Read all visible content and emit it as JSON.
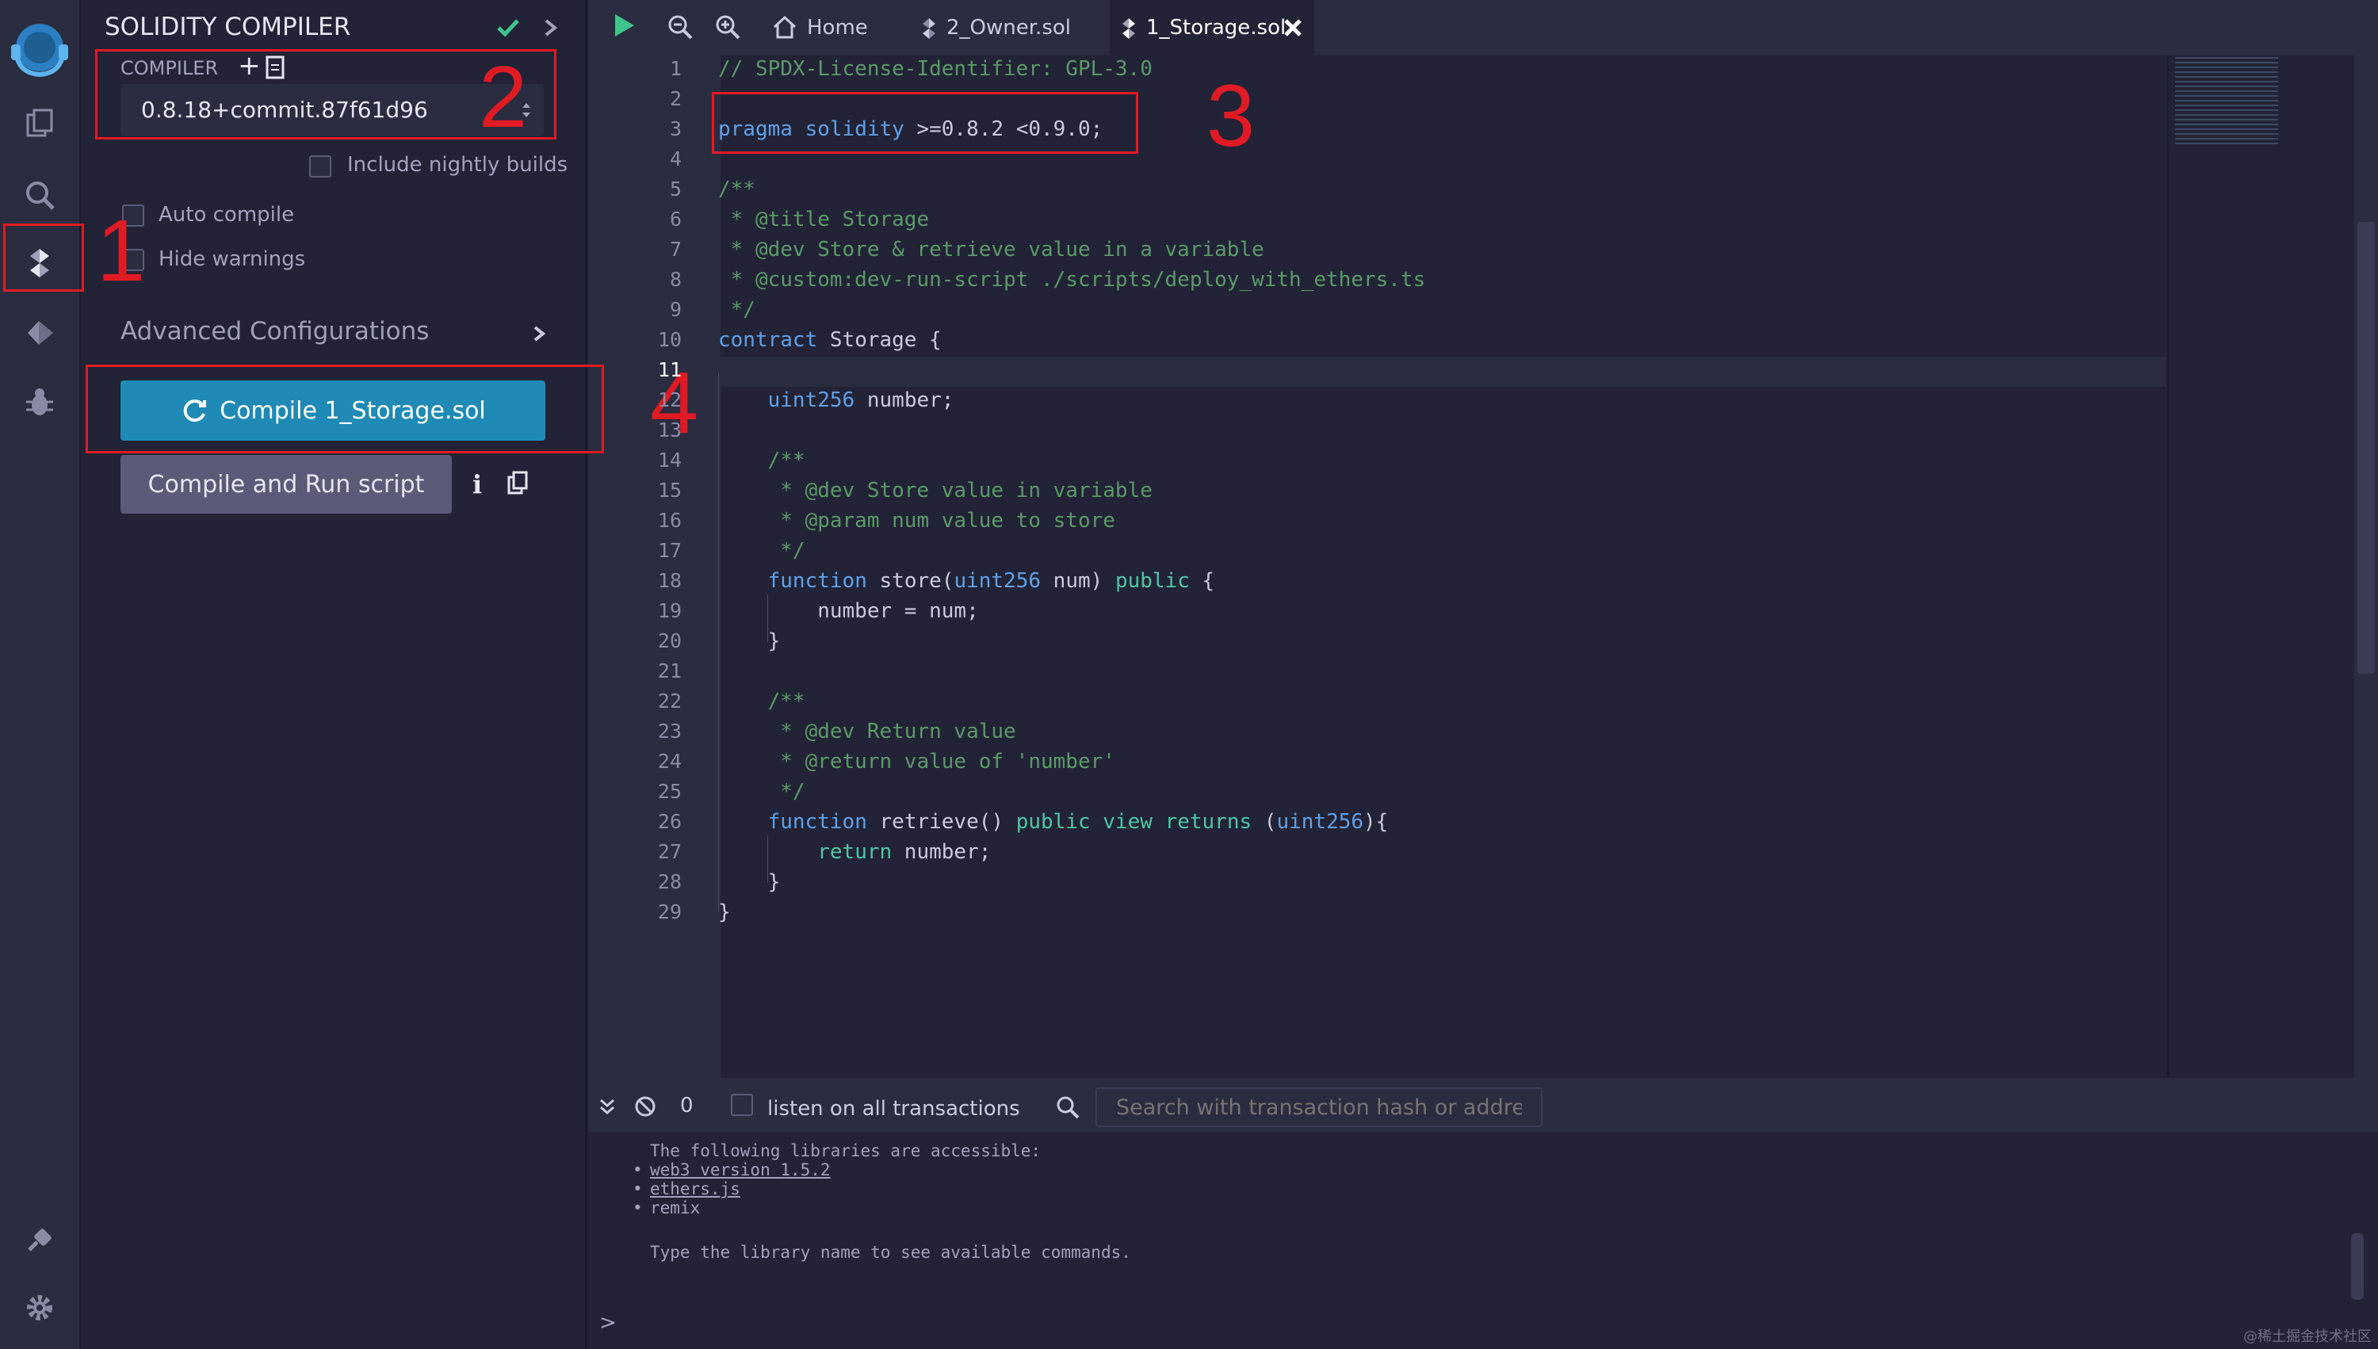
{
  "app": {
    "name": "Remix IDE"
  },
  "colors": {
    "accent": "#1e8ab5",
    "annotation": "#e01b24",
    "success": "#3dc48d"
  },
  "rail": {
    "items": [
      "remix-logo-icon",
      "file-explorer-icon",
      "search-icon",
      "solidity-compiler-icon",
      "deploy-run-icon",
      "debugger-icon",
      "plugin-manager-icon",
      "settings-icon"
    ]
  },
  "panel": {
    "title": "SOLIDITY COMPILER",
    "compiler_label": "COMPILER",
    "compiler_version": "0.8.18+commit.87f61d96",
    "include_nightly": "Include nightly builds",
    "auto_compile": "Auto compile",
    "hide_warnings": "Hide warnings",
    "advanced": "Advanced Configurations",
    "compile_button": "Compile 1_Storage.sol",
    "compile_run_button": "Compile and Run script"
  },
  "tabs": [
    {
      "label": "Home",
      "icon": "home-icon"
    },
    {
      "label": "2_Owner.sol",
      "icon": "solidity-file-icon"
    },
    {
      "label": "1_Storage.sol",
      "icon": "solidity-file-icon",
      "active": true
    }
  ],
  "editor": {
    "active_line": 11,
    "lines": [
      "// SPDX-License-Identifier: GPL-3.0",
      "",
      "pragma solidity >=0.8.2 <0.9.0;",
      "",
      "/**",
      " * @title Storage",
      " * @dev Store & retrieve value in a variable",
      " * @custom:dev-run-script ./scripts/deploy_with_ethers.ts",
      " */",
      "contract Storage {",
      "",
      "    uint256 number;",
      "",
      "    /**",
      "     * @dev Store value in variable",
      "     * @param num value to store",
      "     */",
      "    function store(uint256 num) public {",
      "        number = num;",
      "    }",
      "",
      "    /**",
      "     * @dev Return value",
      "     * @return value of 'number'",
      "     */",
      "    function retrieve() public view returns (uint256){",
      "        return number;",
      "    }",
      "}"
    ]
  },
  "terminal": {
    "pending_count": "0",
    "listen_label": "listen on all transactions",
    "search_placeholder": "Search with transaction hash or address",
    "intro": "The following libraries are accessible:",
    "libs": [
      "web3 version 1.5.2",
      "ethers.js",
      "remix"
    ],
    "hint": "Type the library name to see available commands.",
    "prompt": ">"
  },
  "annotations": [
    "1",
    "2",
    "3",
    "4"
  ],
  "watermark": "@稀土掘金技术社区"
}
